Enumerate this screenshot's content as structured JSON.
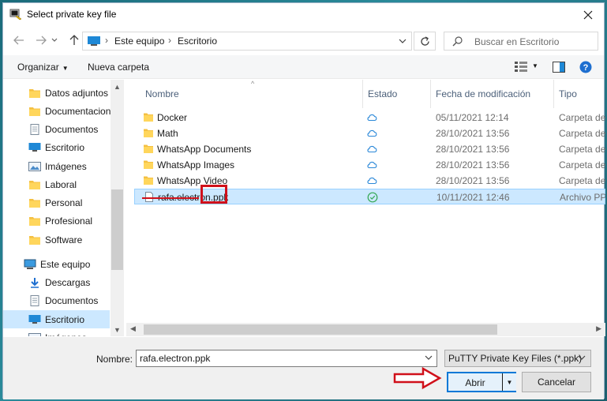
{
  "window": {
    "title": "Select private key file"
  },
  "address": {
    "crumbs": [
      "Este equipo",
      "Escritorio"
    ]
  },
  "search": {
    "placeholder": "Buscar en Escritorio"
  },
  "toolbar": {
    "organize": "Organizar",
    "new_folder": "Nueva carpeta"
  },
  "sidebar": {
    "items": [
      {
        "label": "Datos adjuntos",
        "icon": "folder-icon"
      },
      {
        "label": "Documentacion",
        "icon": "folder-icon"
      },
      {
        "label": "Documentos",
        "icon": "documents-icon"
      },
      {
        "label": "Escritorio",
        "icon": "desktop-icon"
      },
      {
        "label": "Imágenes",
        "icon": "pictures-icon"
      },
      {
        "label": "Laboral",
        "icon": "folder-icon"
      },
      {
        "label": "Personal",
        "icon": "folder-icon"
      },
      {
        "label": "Profesional",
        "icon": "folder-icon"
      },
      {
        "label": "Software",
        "icon": "folder-icon"
      },
      {
        "label": "Este equipo",
        "icon": "computer-icon"
      },
      {
        "label": "Descargas",
        "icon": "downloads-icon"
      },
      {
        "label": "Documentos",
        "icon": "documents-icon"
      },
      {
        "label": "Escritorio",
        "icon": "desktop-icon",
        "selected": true
      },
      {
        "label": "Imágenes",
        "icon": "pictures-icon"
      }
    ]
  },
  "columns": {
    "name": "Nombre",
    "status": "Estado",
    "modified": "Fecha de modificación",
    "type": "Tipo"
  },
  "files": [
    {
      "name": "Docker",
      "status": "cloud",
      "modified": "05/11/2021 12:14",
      "type": "Carpeta de",
      "kind": "folder"
    },
    {
      "name": "Math",
      "status": "cloud",
      "modified": "28/10/2021 13:56",
      "type": "Carpeta de",
      "kind": "folder"
    },
    {
      "name": "WhatsApp Documents",
      "status": "cloud",
      "modified": "28/10/2021 13:56",
      "type": "Carpeta de",
      "kind": "folder"
    },
    {
      "name": "WhatsApp Images",
      "status": "cloud",
      "modified": "28/10/2021 13:56",
      "type": "Carpeta de",
      "kind": "folder"
    },
    {
      "name": "WhatsApp Video",
      "status": "cloud",
      "modified": "28/10/2021 13:56",
      "type": "Carpeta de",
      "kind": "folder"
    },
    {
      "name": "rafa.electron.ppk",
      "status": "synced",
      "modified": "10/11/2021 12:46",
      "type": "Archivo PPK",
      "kind": "file",
      "selected": true
    }
  ],
  "footer": {
    "filename_label": "Nombre:",
    "filename_value": "rafa.electron.ppk",
    "filter": "PuTTY Private Key Files (*.ppk)",
    "open": "Abrir",
    "cancel": "Cancelar"
  },
  "colors": {
    "selection": "#cce8ff",
    "accent": "#0078d7",
    "annotation": "#d0101a",
    "cloud": "#2b88d8",
    "synced": "#34a853"
  }
}
